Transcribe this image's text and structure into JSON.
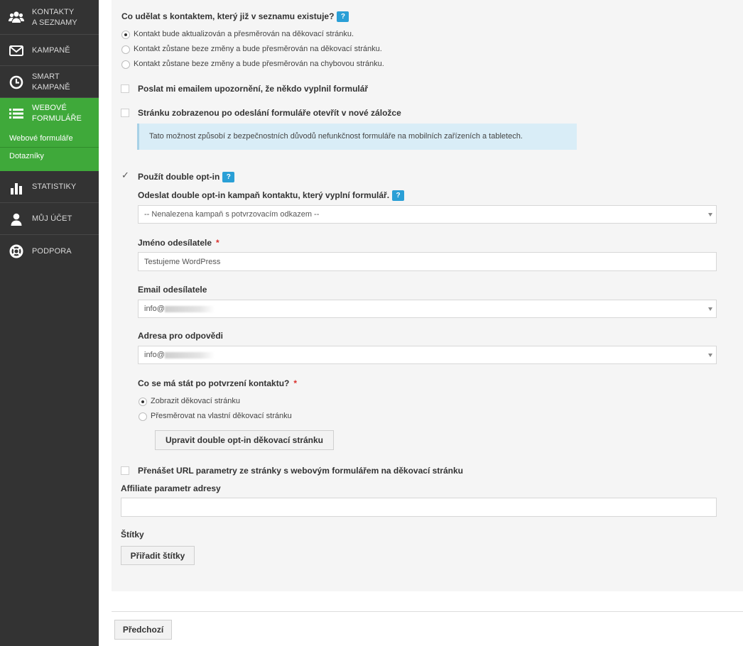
{
  "sidebar": {
    "items": [
      {
        "label_1": "KONTAKTY",
        "label_2": "A SEZNAMY",
        "icon": "users-icon"
      },
      {
        "label_1": "KAMPANĚ",
        "icon": "envelope-icon"
      },
      {
        "label_1": "SMART",
        "label_2": "KAMPANĚ",
        "icon": "clock-icon"
      },
      {
        "label_1": "WEBOVÉ",
        "label_2": "FORMULÁŘE",
        "icon": "list-icon"
      },
      {
        "label_1": "STATISTIKY",
        "icon": "bar-chart-icon"
      },
      {
        "label_1": "MŮJ ÚČET",
        "icon": "user-icon"
      },
      {
        "label_1": "PODPORA",
        "icon": "lifebuoy-icon"
      }
    ],
    "sub_items": [
      "Webové formuláře",
      "Dotazníky"
    ]
  },
  "existing_contact": {
    "heading": "Co udělat s kontaktem, který již v seznamu existuje?",
    "help": "?",
    "options": [
      "Kontakt bude aktualizován a přesměrován na děkovací stránku.",
      "Kontakt zůstane beze změny a bude přesměrován na děkovací stránku.",
      "Kontakt zůstane beze změny a bude přesměrován na chybovou stránku."
    ],
    "selected_index": 0
  },
  "notify_email": {
    "label": "Poslat mi emailem upozornění, že někdo vyplnil formulář",
    "checked": false
  },
  "new_tab": {
    "label": "Stránku zobrazenou po odeslání formuláře otevřít v nové záložce",
    "checked": false,
    "info": "Tato možnost způsobí z bezpečnostních důvodů nefunkčnost formuláře na mobilních zařízeních a tabletech."
  },
  "double_optin": {
    "label": "Použít double opt-in",
    "help": "?",
    "checked": true,
    "campaign_label": "Odeslat double opt-in kampaň kontaktu, který vyplní formulář.",
    "campaign_help": "?",
    "campaign_value": "-- Nenalezena kampaň s potvrzovacím odkazem --",
    "sender_name_label": "Jméno odesílatele",
    "required_mark": "*",
    "sender_name_value": "Testujeme WordPress",
    "sender_email_label": "Email odesílatele",
    "sender_email_value": "info@",
    "reply_label": "Adresa pro odpovědi",
    "reply_value": "info@",
    "after_confirm_label": "Co se má stát po potvrzení kontaktu?",
    "after_confirm_options": [
      "Zobrazit děkovací stránku",
      "Přesměrovat na vlastní děkovací stránku"
    ],
    "after_confirm_selected": 0,
    "edit_button": "Upravit double opt-in děkovací stránku"
  },
  "url_params": {
    "label": "Přenášet URL parametry ze stránky s webovým formulářem na děkovací stránku",
    "checked": false
  },
  "affiliate": {
    "label": "Affiliate parametr adresy",
    "value": ""
  },
  "tags": {
    "label": "Štítky",
    "button": "Přiřadit štítky"
  },
  "footer": {
    "prev_button": "Předchozí"
  }
}
